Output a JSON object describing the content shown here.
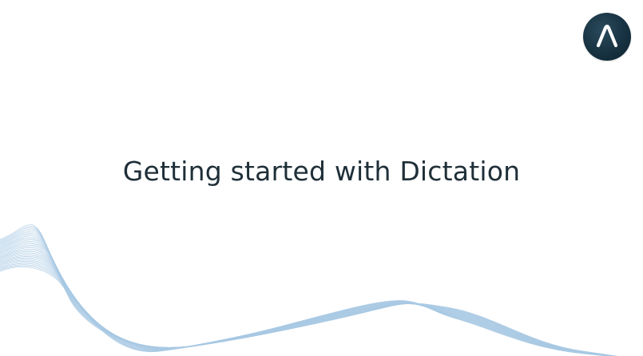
{
  "slide": {
    "title": "Getting started with Dictation"
  },
  "logo": {
    "icon": "chevron-a-icon",
    "background": "#16303f",
    "glyph_color": "#ffffff"
  },
  "decoration": {
    "wave_color": "#a9c9e4"
  }
}
